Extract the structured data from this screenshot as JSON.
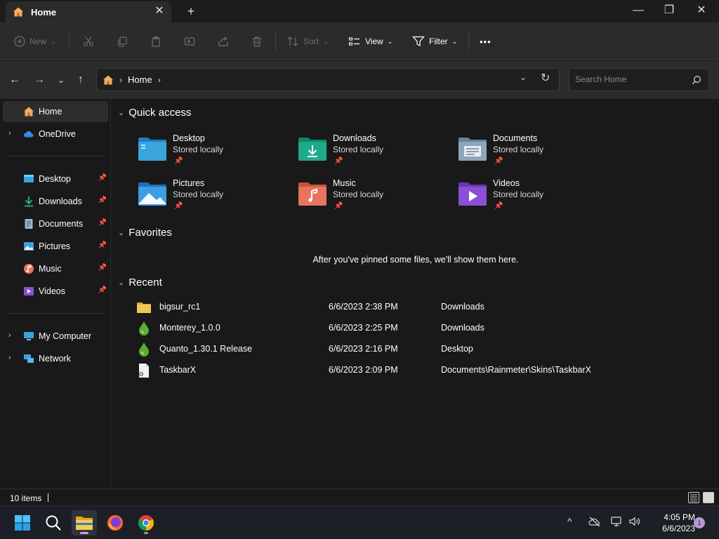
{
  "window": {
    "tab_title": "Home",
    "tab_close": "✕",
    "new_tab": "+",
    "minimize": "—",
    "maximize": "❐",
    "close": "✕"
  },
  "toolbar": {
    "new_label": "New",
    "sort_label": "Sort",
    "view_label": "View",
    "filter_label": "Filter",
    "more_label": "•••"
  },
  "address": {
    "crumb_home": "Home",
    "search_placeholder": "Search Home"
  },
  "sidebar": {
    "home": "Home",
    "onedrive": "OneDrive",
    "pinned": [
      {
        "label": "Desktop",
        "icon": "desktop-icon"
      },
      {
        "label": "Downloads",
        "icon": "downloads-icon"
      },
      {
        "label": "Documents",
        "icon": "documents-icon"
      },
      {
        "label": "Pictures",
        "icon": "pictures-icon"
      },
      {
        "label": "Music",
        "icon": "music-icon"
      },
      {
        "label": "Videos",
        "icon": "videos-icon"
      }
    ],
    "my_computer": "My Computer",
    "network": "Network"
  },
  "sections": {
    "quick_access": "Quick access",
    "favorites": "Favorites",
    "recent": "Recent",
    "favorites_empty": "After you've pinned some files, we'll show them here."
  },
  "quick_access": [
    {
      "name": "Desktop",
      "sub": "Stored locally",
      "color": "#38a6dc"
    },
    {
      "name": "Downloads",
      "sub": "Stored locally",
      "color": "#1fa98b"
    },
    {
      "name": "Documents",
      "sub": "Stored locally",
      "color": "#8fa4bd"
    },
    {
      "name": "Pictures",
      "sub": "Stored locally",
      "color": "#3d9ee5"
    },
    {
      "name": "Music",
      "sub": "Stored locally",
      "color": "#e9735c"
    },
    {
      "name": "Videos",
      "sub": "Stored locally",
      "color": "#8a4fd6"
    }
  ],
  "recent": [
    {
      "name": "bigsur_rc1",
      "date": "6/6/2023 2:38 PM",
      "location": "Downloads",
      "icon": "folder-icon"
    },
    {
      "name": "Monterey_1.0.0",
      "date": "6/6/2023 2:25 PM",
      "location": "Downloads",
      "icon": "droplet-icon"
    },
    {
      "name": "Quanto_1.30.1 Release",
      "date": "6/6/2023 2:16 PM",
      "location": "Desktop",
      "icon": "droplet-icon"
    },
    {
      "name": "TaskbarX",
      "date": "6/6/2023 2:09 PM",
      "location": "Documents\\Rainmeter\\Skins\\TaskbarX",
      "icon": "file-icon"
    }
  ],
  "status": {
    "item_count": "10 items"
  },
  "taskbar": {
    "time": "4:05 PM",
    "date": "6/6/2023",
    "notifications": "1"
  },
  "colors": {
    "accent": "#c7a0e8",
    "background": "#191919",
    "toolbar": "#2b2b2b"
  }
}
